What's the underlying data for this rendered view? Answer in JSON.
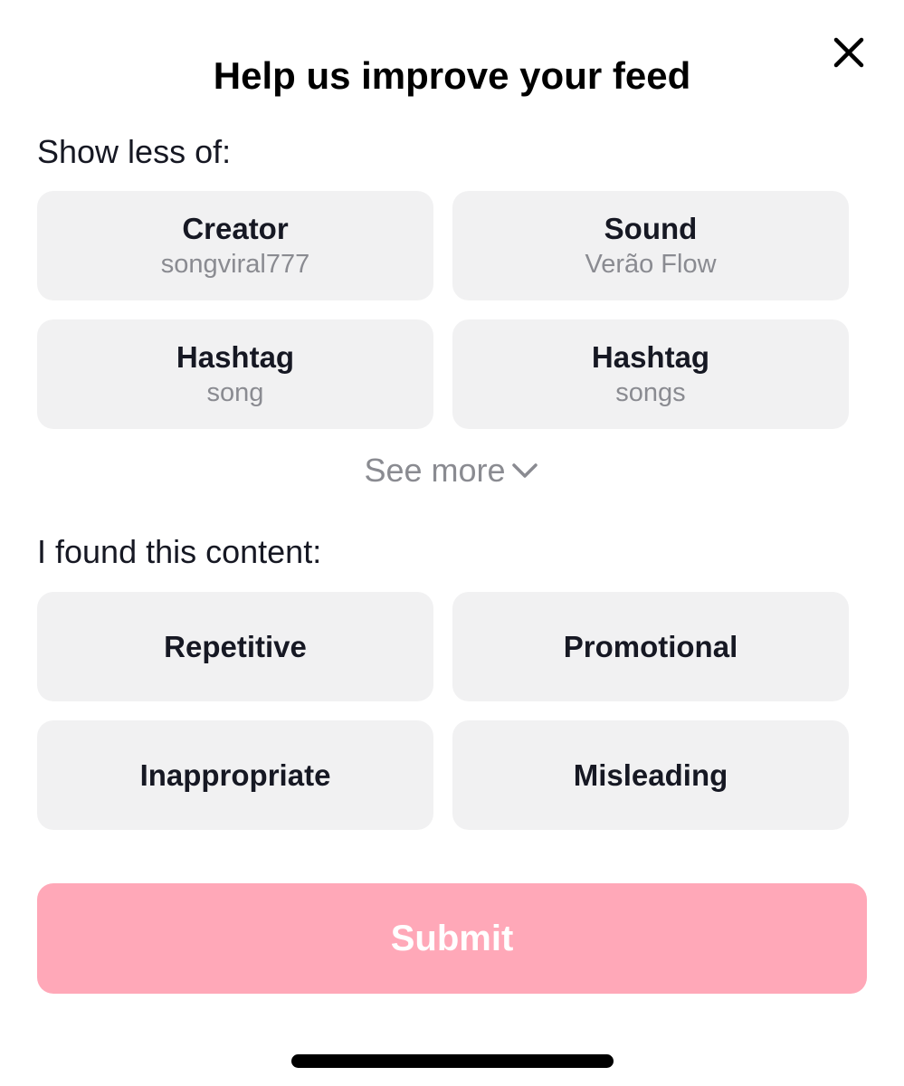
{
  "header": {
    "title": "Help us improve your feed",
    "close_icon": "close-icon"
  },
  "show_less": {
    "label": "Show less of:",
    "items": [
      {
        "type": "Creator",
        "value": "songviral777"
      },
      {
        "type": "Sound",
        "value": "Verão Flow"
      },
      {
        "type": "Hashtag",
        "value": "song"
      },
      {
        "type": "Hashtag",
        "value": "songs"
      }
    ],
    "see_more_label": "See more",
    "see_more_icon": "chevron-down-icon"
  },
  "found_content": {
    "label": "I found this content:",
    "items": [
      {
        "label": "Repetitive"
      },
      {
        "label": "Promotional"
      },
      {
        "label": "Inappropriate"
      },
      {
        "label": "Misleading"
      }
    ]
  },
  "submit": {
    "label": "Submit"
  },
  "colors": {
    "card_bg": "#f1f1f2",
    "submit_bg_disabled": "#ffa8b8",
    "secondary_text": "#8a8b91"
  }
}
